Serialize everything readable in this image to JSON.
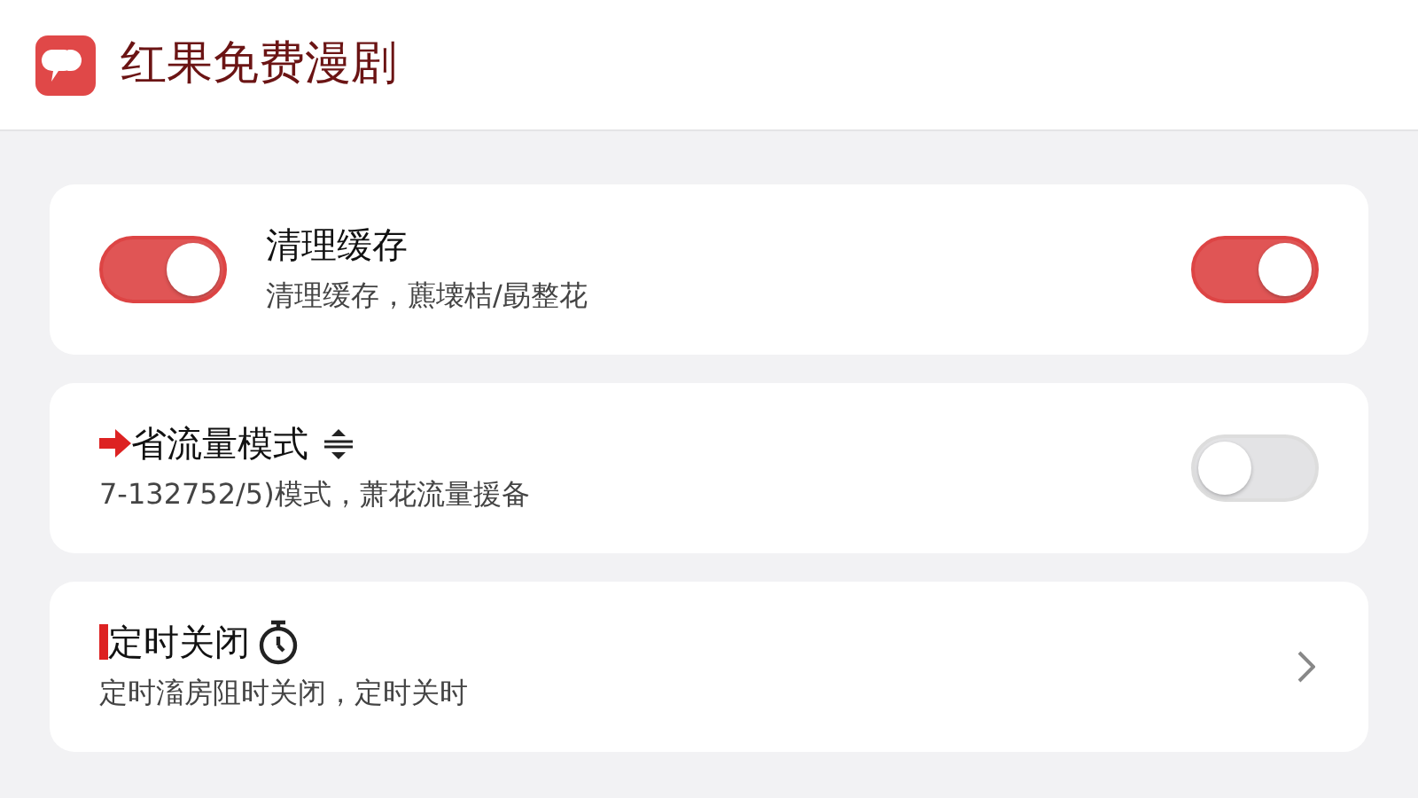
{
  "app": {
    "title": "红果免费漫剧"
  },
  "settings": [
    {
      "kind": "toggle",
      "title": "清理缓存",
      "subtitle": "清理缓存，藨壊桔/勗整花",
      "on": true,
      "leading_toggle": {
        "on": true
      }
    },
    {
      "kind": "toggle",
      "title": "省流量模式",
      "subtitle": "7-132752/5)模式，萧花流量援备",
      "on": false
    },
    {
      "kind": "link",
      "title": "定时关闭",
      "subtitle": "定时滀房阻时关闭，定时关时"
    }
  ]
}
